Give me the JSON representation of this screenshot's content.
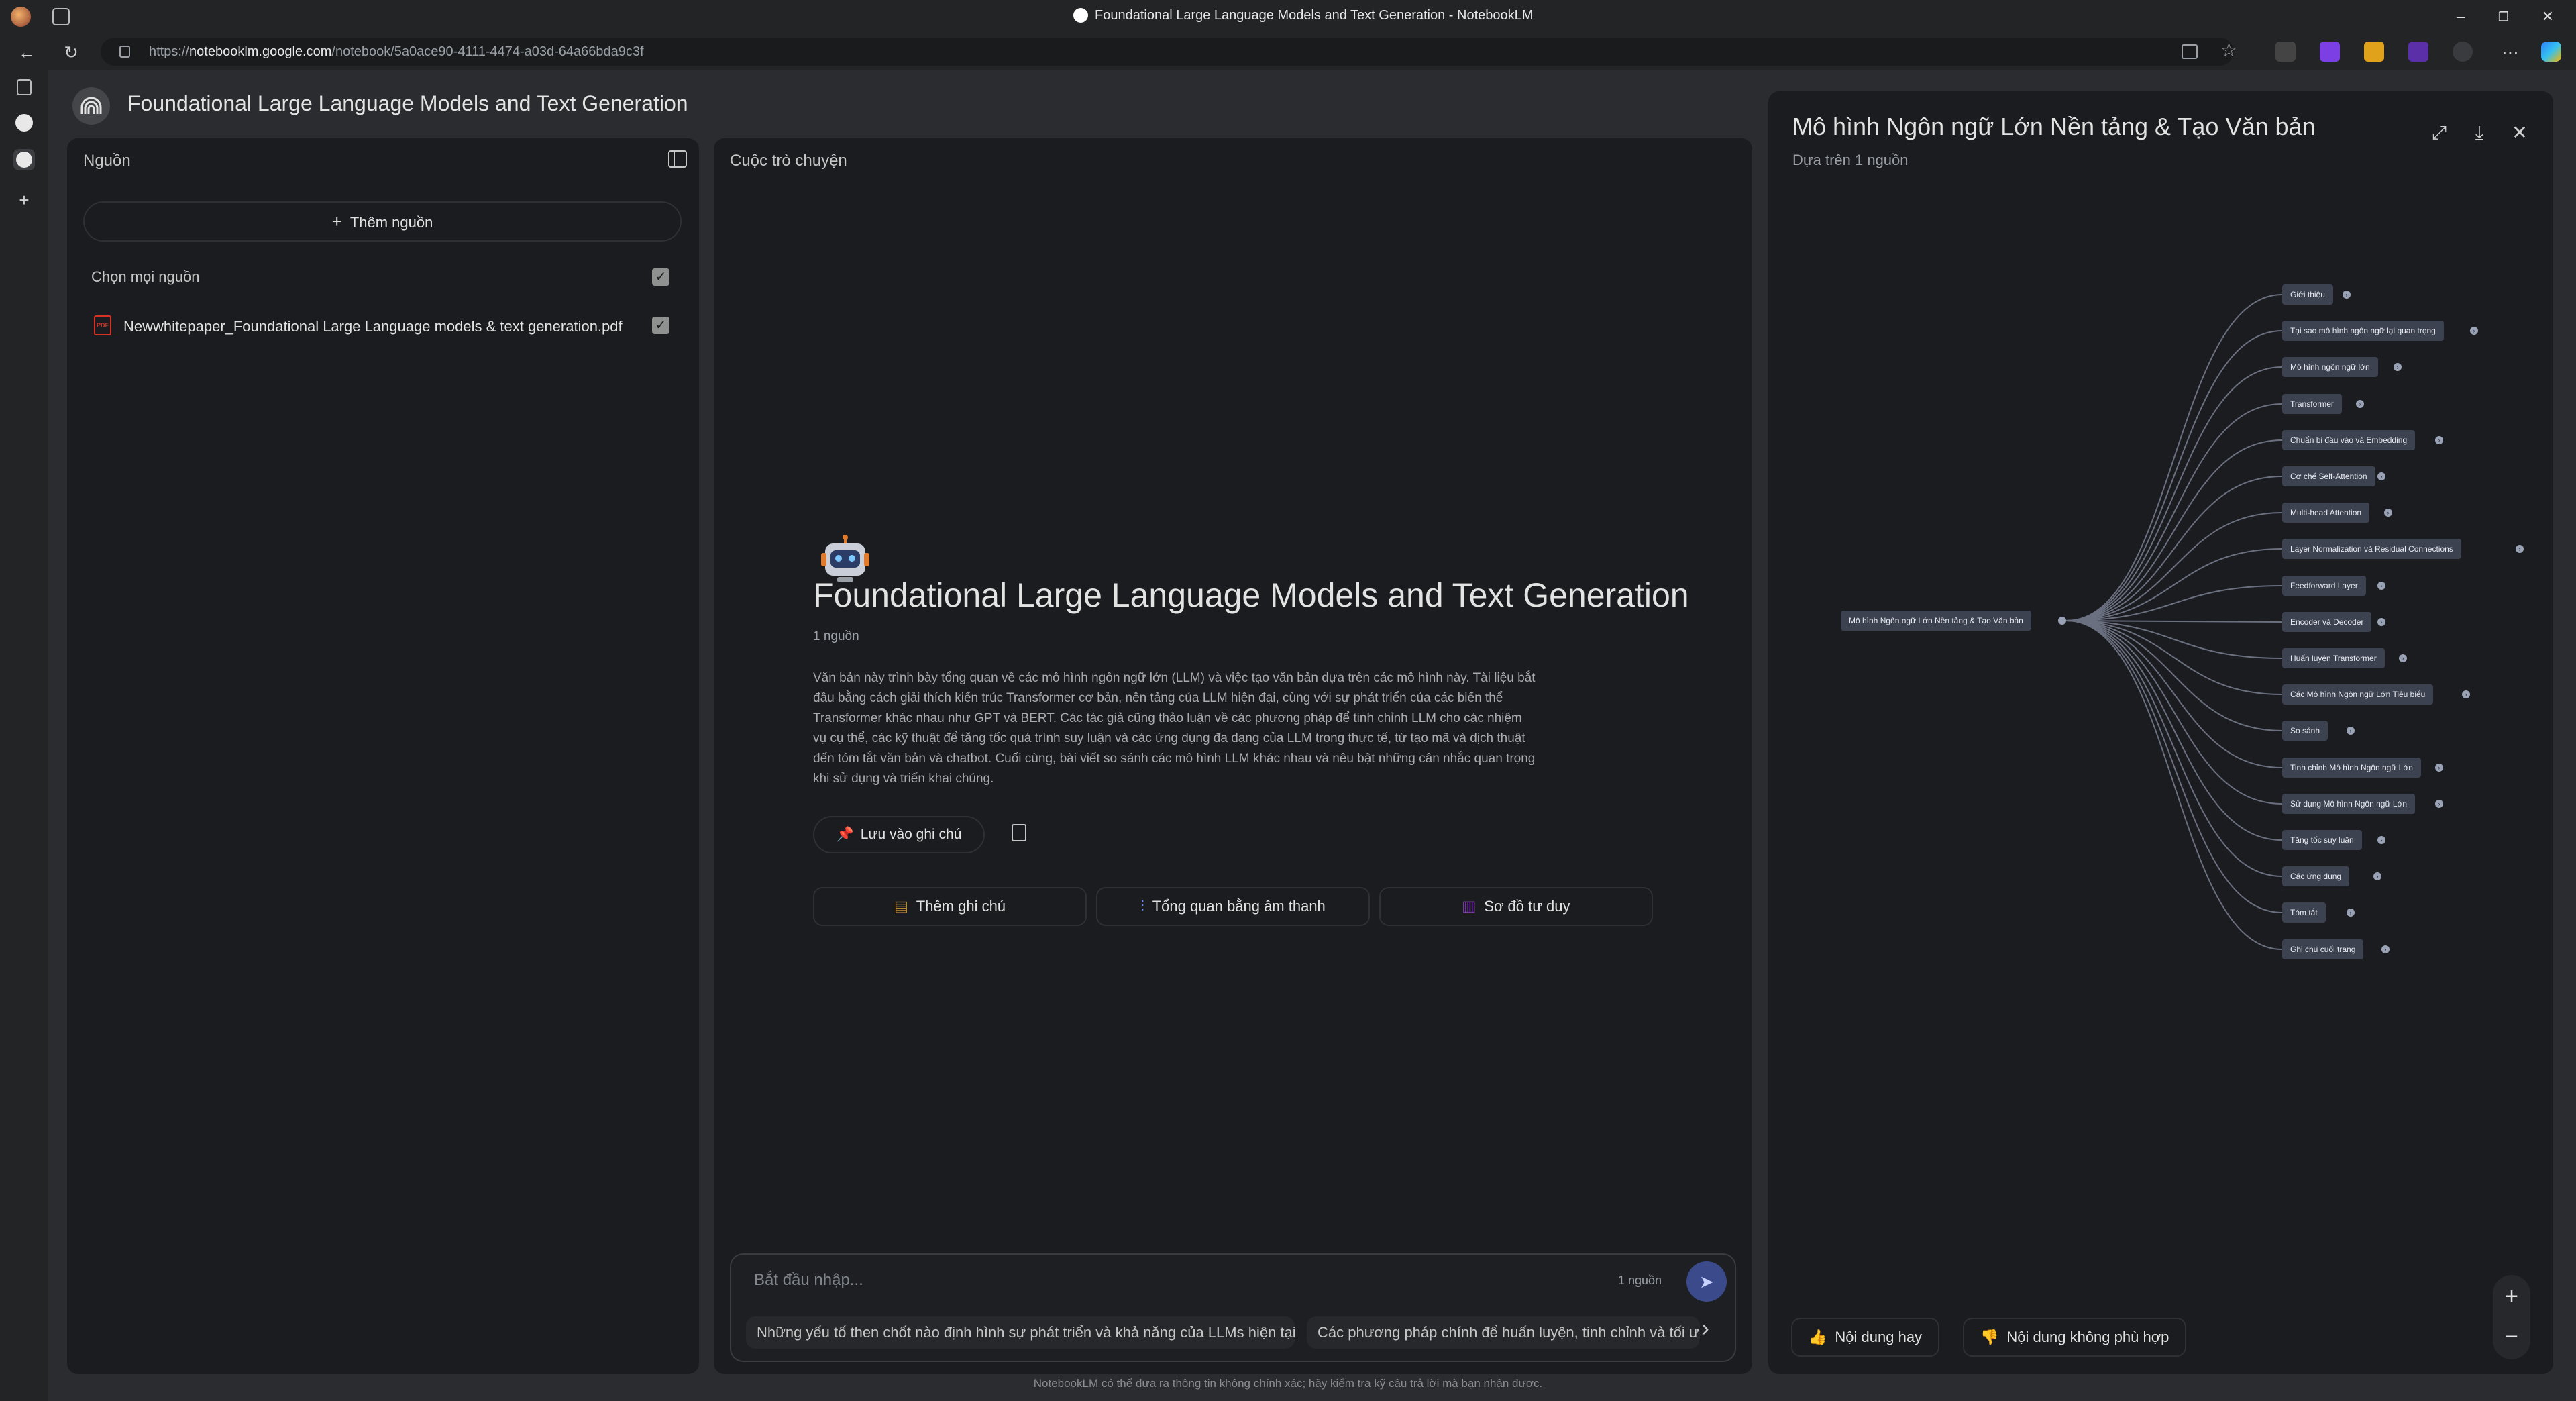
{
  "browser": {
    "window_title": "Foundational Large Language Models and Text Generation - NotebookLM",
    "url_prefix": "https://",
    "url_host": "notebooklm.google.com",
    "url_path": "/notebook/5a0ace90-4111-4474-a03d-64a66bda9c3f",
    "minimize": "–",
    "restore": "❐",
    "close": "✕",
    "back": "←",
    "reload": "↻",
    "new_tab": "+",
    "more": "⋯"
  },
  "notebook": {
    "title": "Foundational Large Language Models and Text Generation"
  },
  "sources": {
    "label": "Nguồn",
    "add_label": "Thêm nguồn",
    "select_all_label": "Chọn mọi nguồn",
    "check": "✓",
    "items": [
      {
        "name": "Newwhitepaper_Foundational Large Language models & text generation.pdf",
        "icon_text": "PDF"
      }
    ]
  },
  "chat": {
    "label": "Cuộc trò chuyện",
    "title": "Foundational Large Language Models and Text Generation",
    "source_count": "1 nguồn",
    "summary": "Văn bản này trình bày tổng quan về các mô hình ngôn ngữ lớn (LLM) và việc tạo văn bản dựa trên các mô hình này. Tài liệu bắt đầu bằng cách giải thích kiến trúc Transformer cơ bản, nền tảng của LLM hiện đại, cùng với sự phát triển của các biến thể Transformer khác nhau như GPT và BERT. Các tác giả cũng thảo luận về các phương pháp để tinh chỉnh LLM cho các nhiệm vụ cụ thể, các kỹ thuật để tăng tốc quá trình suy luận và các ứng dụng đa dạng của LLM trong thực tế, từ tạo mã và dịch thuật đến tóm tắt văn bản và chatbot. Cuối cùng, bài viết so sánh các mô hình LLM khác nhau và nêu bật những cân nhắc quan trọng khi sử dụng và triển khai chúng.",
    "save_note_label": "Lưu vào ghi chú",
    "actions": {
      "add_note": "Thêm ghi chú",
      "audio_overview": "Tổng quan bằng âm thanh",
      "mind_map": "Sơ đồ tư duy"
    },
    "input_placeholder": "Bắt đầu nhập...",
    "input_source_count": "1 nguồn",
    "send": "➤",
    "next": "›",
    "suggestions": [
      "Những yếu tố then chốt nào định hình sự phát triển và khả năng của LLMs hiện tại?",
      "Các phương pháp chính để huấn luyện, tinh chỉnh và tối ưu"
    ],
    "disclaimer": "NotebookLM có thể đưa ra thông tin không chính xác; hãy kiểm tra kỹ câu trả lời mà bạn nhận được."
  },
  "mindmap": {
    "title": "Mô hình Ngôn ngữ Lớn Nền tảng & Tạo Văn bản",
    "subtitle": "Dựa trên 1 nguồn",
    "root": "Mô hình Ngôn ngữ Lớn Nền tảng & Tạo Văn bản",
    "expand": "›",
    "children": [
      "Giới thiệu",
      "Tại sao mô hình ngôn ngữ lại quan trọng",
      "Mô hình ngôn ngữ lớn",
      "Transformer",
      "Chuẩn bị đầu vào và Embedding",
      "Cơ chế Self-Attention",
      "Multi-head Attention",
      "Layer Normalization và Residual Connections",
      "Feedforward Layer",
      "Encoder và Decoder",
      "Huấn luyện Transformer",
      "Các Mô hình Ngôn ngữ Lớn Tiêu biểu",
      "So sánh",
      "Tinh chỉnh Mô hình Ngôn ngữ Lớn",
      "Sử dụng Mô hình Ngôn ngữ Lớn",
      "Tăng tốc suy luận",
      "Các ứng dụng",
      "Tóm tắt",
      "Ghi chú cuối trang"
    ],
    "fullscreen": "⤢",
    "download": "⤓",
    "close": "✕",
    "zoom_in": "+",
    "zoom_out": "−",
    "feedback_good": "Nội dung hay",
    "feedback_bad": "Nội dung không phù hợp"
  },
  "colors": {
    "accent": "#3a4a8a",
    "node_bg": "#3c4250",
    "edge": "#6b7080"
  }
}
